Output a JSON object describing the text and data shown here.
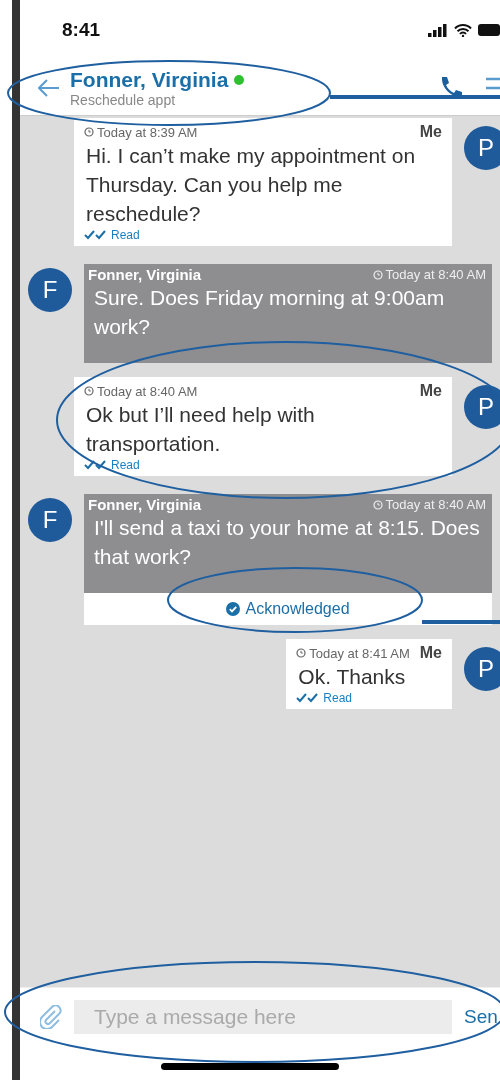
{
  "status_bar": {
    "time": "8:41"
  },
  "header": {
    "name": "Fonner, Virginia",
    "online": true,
    "subtitle": "Reschedule appt"
  },
  "messages": [
    {
      "kind": "outgoing",
      "sender": "Me",
      "avatar": "P",
      "time": "Today at 8:39 AM",
      "text": "Hi. I can’t make my appointment on Thursday. Can you help me reschedule?",
      "status": "Read"
    },
    {
      "kind": "incoming",
      "sender": "Fonner, Virginia",
      "avatar": "F",
      "time": "Today at 8:40 AM",
      "text": "Sure. Does Friday morning at 9:00am work?"
    },
    {
      "kind": "outgoing",
      "sender": "Me",
      "avatar": "P",
      "time": "Today at 8:40 AM",
      "text": "Ok but I’ll need help with transportation.",
      "status": "Read"
    },
    {
      "kind": "incoming",
      "sender": "Fonner, Virginia",
      "avatar": "F",
      "time": "Today at 8:40 AM",
      "text": "I'll send a taxi to your home at 8:15. Does that work?",
      "acknowledgement": "Acknowledged"
    },
    {
      "kind": "outgoing",
      "sender": "Me",
      "avatar": "P",
      "time": "Today at 8:41 AM",
      "text": "Ok. Thanks",
      "status": "Read"
    }
  ],
  "composer": {
    "placeholder": "Type a message here",
    "send": "Sen"
  }
}
